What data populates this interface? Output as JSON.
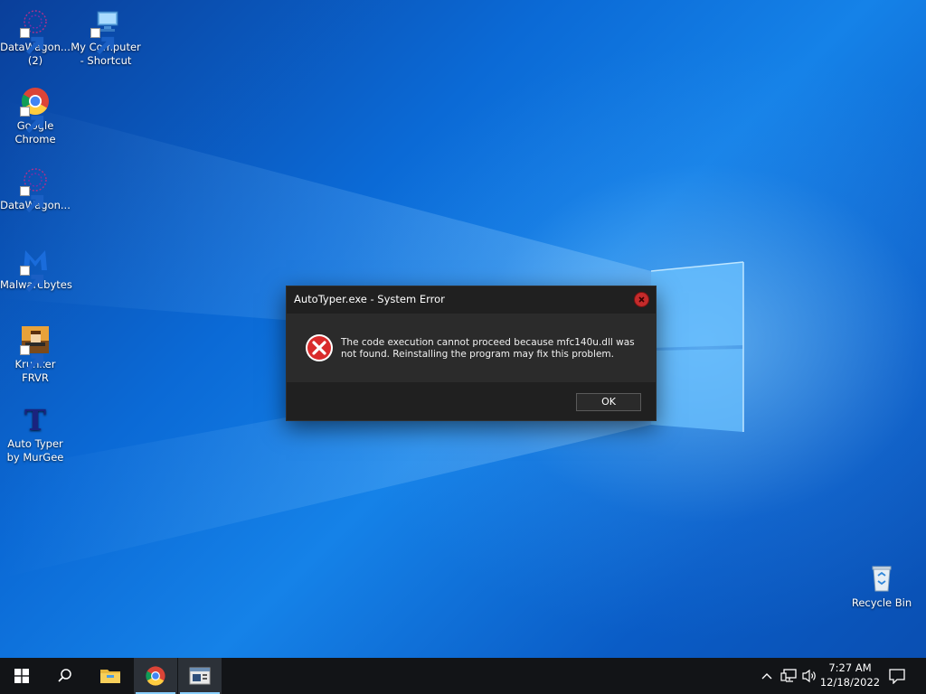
{
  "desktop": {
    "icons": [
      {
        "label": "DataWagon... (2)",
        "icon": "datawagon-icon"
      },
      {
        "label": "My Computer - Shortcut",
        "icon": "computer-icon"
      },
      {
        "label": "Google Chrome",
        "icon": "chrome-icon"
      },
      {
        "label": "DataWagon...",
        "icon": "datawagon-icon"
      },
      {
        "label": "Malwarebytes",
        "icon": "malwarebytes-icon"
      },
      {
        "label": "Krunker FRVR",
        "icon": "krunker-icon"
      },
      {
        "label": "Auto Typer by MurGee",
        "icon": "autotyper-icon"
      },
      {
        "label": "Recycle Bin",
        "icon": "recycle-bin-icon"
      }
    ]
  },
  "dialog": {
    "title": "AutoTyper.exe - System Error",
    "message": "The code execution cannot proceed because mfc140u.dll was not found. Reinstalling the program may fix this problem.",
    "ok_label": "OK",
    "icon": "error-icon"
  },
  "taskbar": {
    "buttons": [
      "start-icon",
      "search-icon",
      "file-explorer-icon",
      "chrome-icon",
      "window-icon"
    ],
    "active_button": "chrome-icon",
    "tray": [
      "chevron-up-icon",
      "network-icon",
      "volume-icon"
    ],
    "time": "7:27 AM",
    "date": "12/18/2022",
    "notification_icon": "notification-icon"
  },
  "colors": {
    "accent": "#0b6ad6",
    "error": "#c42b2b",
    "taskbar": "#121417"
  }
}
